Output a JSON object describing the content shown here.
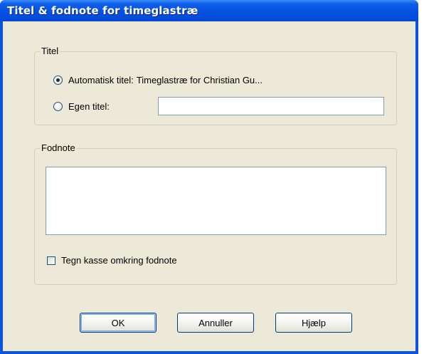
{
  "window": {
    "title": "Titel & fodnote for timeglastræ"
  },
  "title_group": {
    "legend": "Titel",
    "auto_option": {
      "label": "Automatisk titel:",
      "value_text": "Timeglastræ for Christian Gu...",
      "selected": true
    },
    "custom_option": {
      "label": "Egen titel:",
      "selected": false,
      "input_value": ""
    }
  },
  "footnote_group": {
    "legend": "Fodnote",
    "textarea_value": "",
    "box_checkbox": {
      "label": "Tegn kasse omkring fodnote",
      "checked": false
    }
  },
  "buttons": {
    "ok": "OK",
    "cancel": "Annuller",
    "help": "Hjælp"
  }
}
